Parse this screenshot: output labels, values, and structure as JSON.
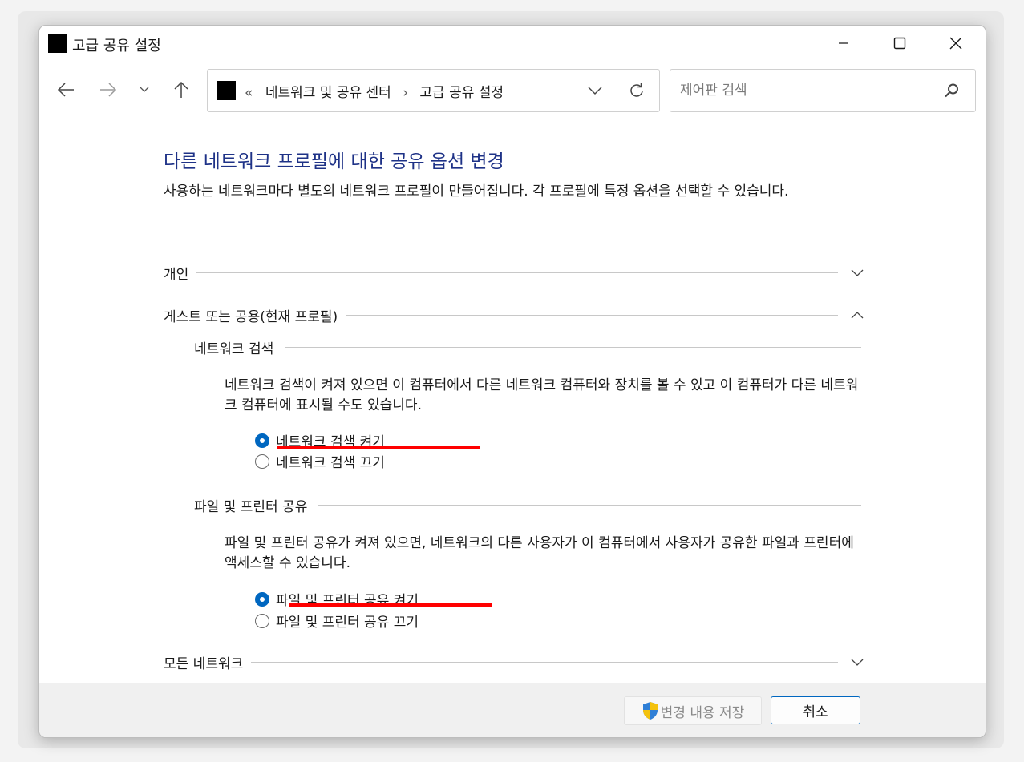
{
  "window": {
    "title": "고급 공유 설정"
  },
  "address": {
    "overflow": "«",
    "crumbs": [
      "네트워크 및 공유 센터",
      "고급 공유 설정"
    ],
    "separator": "›"
  },
  "search": {
    "placeholder": "제어판 검색"
  },
  "page": {
    "title": "다른 네트워크 프로필에 대한 공유 옵션 변경",
    "description": "사용하는 네트워크마다 별도의 네트워크 프로필이 만들어집니다. 각 프로필에 특정 옵션을 선택할 수 있습니다."
  },
  "sections": {
    "private": {
      "label": "개인",
      "expanded": false
    },
    "guest": {
      "label": "게스트 또는 공용(현재 프로필)",
      "expanded": true
    },
    "all": {
      "label": "모든 네트워크",
      "expanded": false
    }
  },
  "network_discovery": {
    "label": "네트워크 검색",
    "description": "네트워크 검색이 켜져 있으면 이 컴퓨터에서 다른 네트워크 컴퓨터와 장치를 볼 수 있고 이 컴퓨터가 다른 네트워크 컴퓨터에 표시될 수도 있습니다.",
    "on_label": "네트워크 검색 켜기",
    "off_label": "네트워크 검색 끄기",
    "selected": "on"
  },
  "file_sharing": {
    "label": "파일 및 프린터 공유",
    "description": "파일 및 프린터 공유가 켜져 있으면, 네트워크의 다른 사용자가 이 컴퓨터에서 사용자가 공유한 파일과 프린터에 액세스할 수 있습니다.",
    "on_label": "파일 및 프린터 공유 켜기",
    "off_label": "파일 및 프린터 공유 끄기",
    "selected": "on"
  },
  "footer": {
    "save_label": "변경 내용 저장",
    "cancel_label": "취소"
  },
  "colors": {
    "title_blue": "#1e3287",
    "accent": "#0067c0",
    "annotation_red": "#ff0000"
  }
}
